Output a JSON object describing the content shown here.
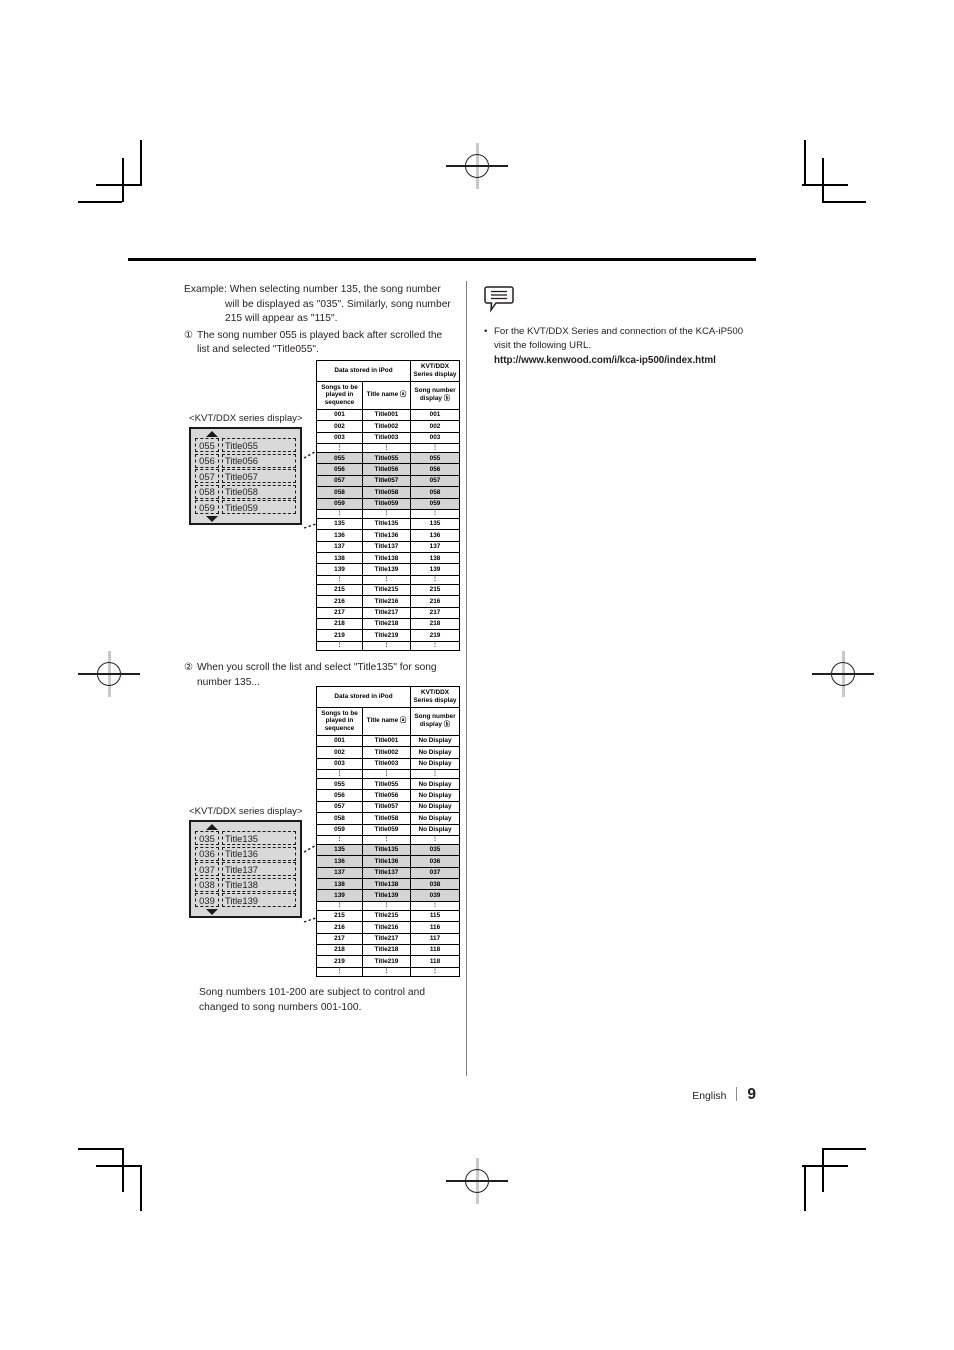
{
  "document": {
    "footer": {
      "language": "English",
      "page_number": "9"
    }
  },
  "left_column": {
    "example": {
      "line1": "Example: When selecting number 135, the song number",
      "line2": "will be displayed as \"035\". Similarly, song number",
      "line3": "215 will appear as \"115\"."
    },
    "step1": {
      "marker": "①",
      "text": "The song number 055 is played back after scrolled the list and selected \"Title055\"."
    },
    "step2": {
      "marker": "②",
      "text": "When you scroll the list and select \"Title135\" for song number 135..."
    },
    "footnote": "Song numbers 101-200 are subject to control and changed to song numbers 001-100."
  },
  "display1": {
    "caption": "<KVT/DDX series display>",
    "arrow_up": "scroll-up",
    "arrow_down": "scroll-down",
    "rows": [
      {
        "num": "055",
        "title": "Title055"
      },
      {
        "num": "056",
        "title": "Title056"
      },
      {
        "num": "057",
        "title": "Title057"
      },
      {
        "num": "058",
        "title": "Title058"
      },
      {
        "num": "059",
        "title": "Title059"
      }
    ]
  },
  "display2": {
    "caption": "<KVT/DDX series display>",
    "arrow_up": "scroll-up",
    "arrow_down": "scroll-down",
    "rows": [
      {
        "num": "035",
        "title": "Title135"
      },
      {
        "num": "036",
        "title": "Title136"
      },
      {
        "num": "037",
        "title": "Title137"
      },
      {
        "num": "038",
        "title": "Title138"
      },
      {
        "num": "039",
        "title": "Title139"
      }
    ]
  },
  "table1": {
    "group_headers": {
      "ipod": "Data stored in iPod",
      "kvt": "KVT/DDX Series display"
    },
    "sub_headers": {
      "sequence": "Songs to be played in sequence",
      "title_name": "Title name ⓐ",
      "song_number": "Song number display ⓑ"
    },
    "rows": [
      {
        "seq": "001",
        "title": "Title001",
        "song": "001",
        "hl": false
      },
      {
        "seq": "002",
        "title": "Title002",
        "song": "002",
        "hl": false
      },
      {
        "seq": "003",
        "title": "Title003",
        "song": "003",
        "hl": false
      },
      {
        "seq": "⋮",
        "title": "⋮",
        "song": "⋮",
        "hl": false,
        "dots": true
      },
      {
        "seq": "055",
        "title": "Title055",
        "song": "055",
        "hl": true
      },
      {
        "seq": "056",
        "title": "Title056",
        "song": "056",
        "hl": true
      },
      {
        "seq": "057",
        "title": "Title057",
        "song": "057",
        "hl": true
      },
      {
        "seq": "058",
        "title": "Title058",
        "song": "058",
        "hl": true
      },
      {
        "seq": "059",
        "title": "Title059",
        "song": "059",
        "hl": true
      },
      {
        "seq": "⋮",
        "title": "⋮",
        "song": "⋮",
        "hl": false,
        "dots": true
      },
      {
        "seq": "135",
        "title": "Title135",
        "song": "135",
        "hl": false
      },
      {
        "seq": "136",
        "title": "Title136",
        "song": "136",
        "hl": false
      },
      {
        "seq": "137",
        "title": "Title137",
        "song": "137",
        "hl": false
      },
      {
        "seq": "138",
        "title": "Title138",
        "song": "138",
        "hl": false
      },
      {
        "seq": "139",
        "title": "Title139",
        "song": "139",
        "hl": false
      },
      {
        "seq": "⋮",
        "title": "⋮",
        "song": "⋮",
        "hl": false,
        "dots": true
      },
      {
        "seq": "215",
        "title": "Title215",
        "song": "215",
        "hl": false
      },
      {
        "seq": "216",
        "title": "Title216",
        "song": "216",
        "hl": false
      },
      {
        "seq": "217",
        "title": "Title217",
        "song": "217",
        "hl": false
      },
      {
        "seq": "218",
        "title": "Title218",
        "song": "218",
        "hl": false
      },
      {
        "seq": "219",
        "title": "Title219",
        "song": "219",
        "hl": false
      },
      {
        "seq": "⋮",
        "title": "⋮",
        "song": "⋮",
        "hl": false,
        "dots": true
      }
    ]
  },
  "table2": {
    "group_headers": {
      "ipod": "Data stored in iPod",
      "kvt": "KVT/DDX Series display"
    },
    "sub_headers": {
      "sequence": "Songs to be played in sequence",
      "title_name": "Title name ⓐ",
      "song_number": "Song number display ⓑ"
    },
    "rows": [
      {
        "seq": "001",
        "title": "Title001",
        "song": "No Display",
        "hl": false
      },
      {
        "seq": "002",
        "title": "Title002",
        "song": "No Display",
        "hl": false
      },
      {
        "seq": "003",
        "title": "Title003",
        "song": "No Display",
        "hl": false
      },
      {
        "seq": "⋮",
        "title": "⋮",
        "song": "⋮",
        "hl": false,
        "dots": true
      },
      {
        "seq": "055",
        "title": "Title055",
        "song": "No Display",
        "hl": false
      },
      {
        "seq": "056",
        "title": "Title056",
        "song": "No Display",
        "hl": false
      },
      {
        "seq": "057",
        "title": "Title057",
        "song": "No Display",
        "hl": false
      },
      {
        "seq": "058",
        "title": "Title058",
        "song": "No Display",
        "hl": false
      },
      {
        "seq": "059",
        "title": "Title059",
        "song": "No Display",
        "hl": false
      },
      {
        "seq": "⋮",
        "title": "⋮",
        "song": "⋮",
        "hl": false,
        "dots": true
      },
      {
        "seq": "135",
        "title": "Title135",
        "song": "035",
        "hl": true
      },
      {
        "seq": "136",
        "title": "Title136",
        "song": "036",
        "hl": true
      },
      {
        "seq": "137",
        "title": "Title137",
        "song": "037",
        "hl": true
      },
      {
        "seq": "138",
        "title": "Title138",
        "song": "038",
        "hl": true
      },
      {
        "seq": "139",
        "title": "Title139",
        "song": "039",
        "hl": true
      },
      {
        "seq": "⋮",
        "title": "⋮",
        "song": "⋮",
        "hl": false,
        "dots": true
      },
      {
        "seq": "215",
        "title": "Title215",
        "song": "115",
        "hl": false
      },
      {
        "seq": "216",
        "title": "Title216",
        "song": "116",
        "hl": false
      },
      {
        "seq": "217",
        "title": "Title217",
        "song": "117",
        "hl": false
      },
      {
        "seq": "218",
        "title": "Title218",
        "song": "118",
        "hl": false
      },
      {
        "seq": "219",
        "title": "Title219",
        "song": "118",
        "hl": false
      },
      {
        "seq": "⋮",
        "title": "⋮",
        "song": "⋮",
        "hl": false,
        "dots": true
      }
    ]
  },
  "right_column": {
    "note_icon": "note-bubble-icon",
    "bullet": "•",
    "note_text": "For the KVT/DDX Series and connection of the KCA-iP500 visit the following URL.",
    "note_url": "http://www.kenwood.com/i/kca-ip500/index.html"
  }
}
